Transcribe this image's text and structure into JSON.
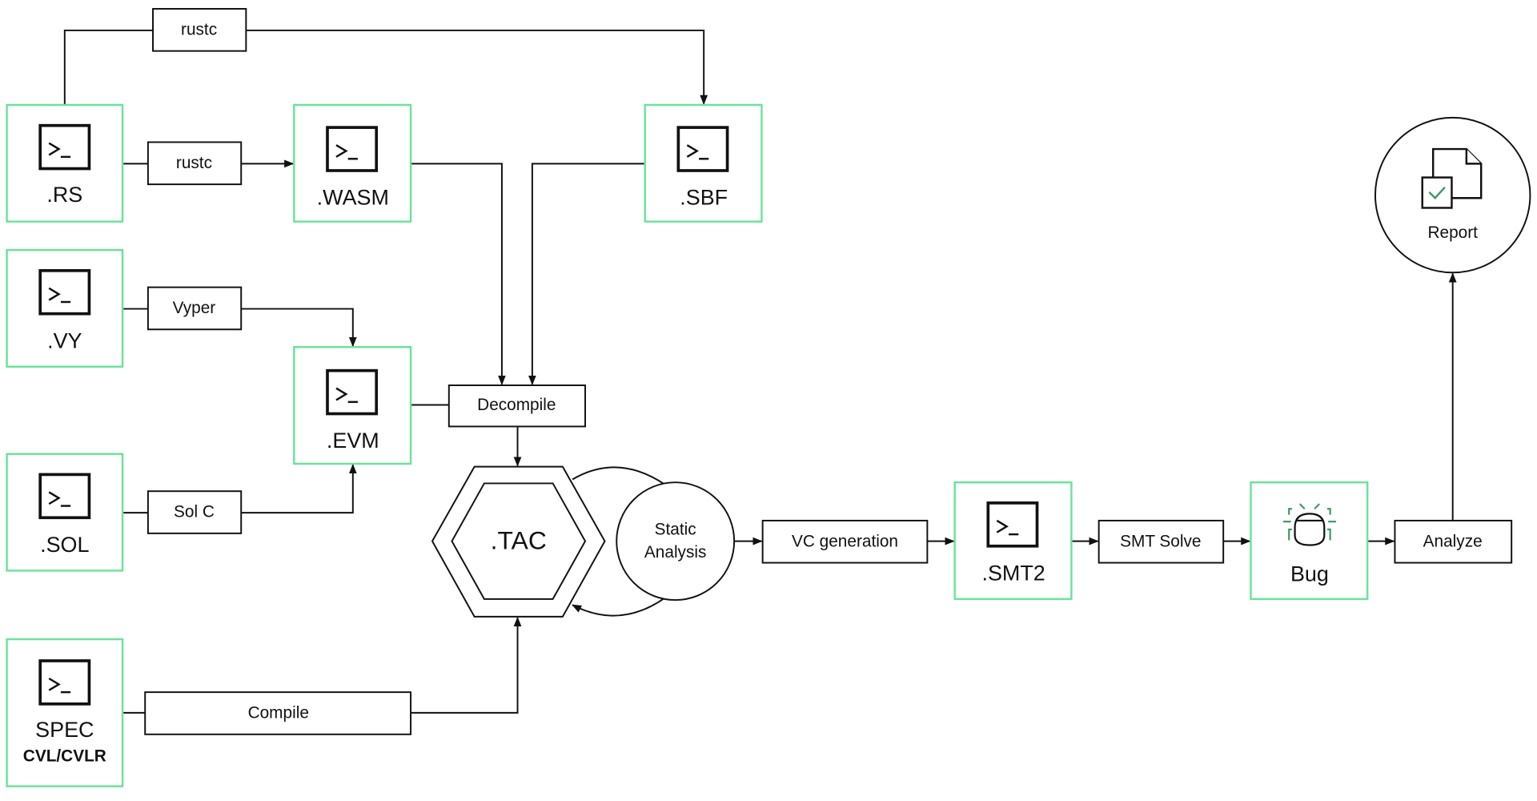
{
  "colors": {
    "node_border": "#6be39a",
    "accent_icon": "#3f9a63",
    "line": "#111111"
  },
  "nodes": {
    "rs": ".RS",
    "wasm": ".WASM",
    "sbf": ".SBF",
    "vy": ".VY",
    "evm": ".EVM",
    "sol": ".SOL",
    "spec": "SPEC",
    "spec_sub": "CVL/CVLR",
    "tac": ".TAC",
    "static_1": "Static",
    "static_2": "Analysis",
    "smt2": ".SMT2",
    "bug": "Bug",
    "report": "Report"
  },
  "steps": {
    "rustc_top": "rustc",
    "rustc_mid": "rustc",
    "vyper": "Vyper",
    "solc": "Sol C",
    "decompile": "Decompile",
    "compile": "Compile",
    "vc": "VC generation",
    "smt_solve": "SMT Solve",
    "analyze": "Analyze"
  },
  "icons": {
    "file_nodes": "terminal-icon",
    "bug": "bug-icon",
    "report": "report-documents-check-icon"
  }
}
